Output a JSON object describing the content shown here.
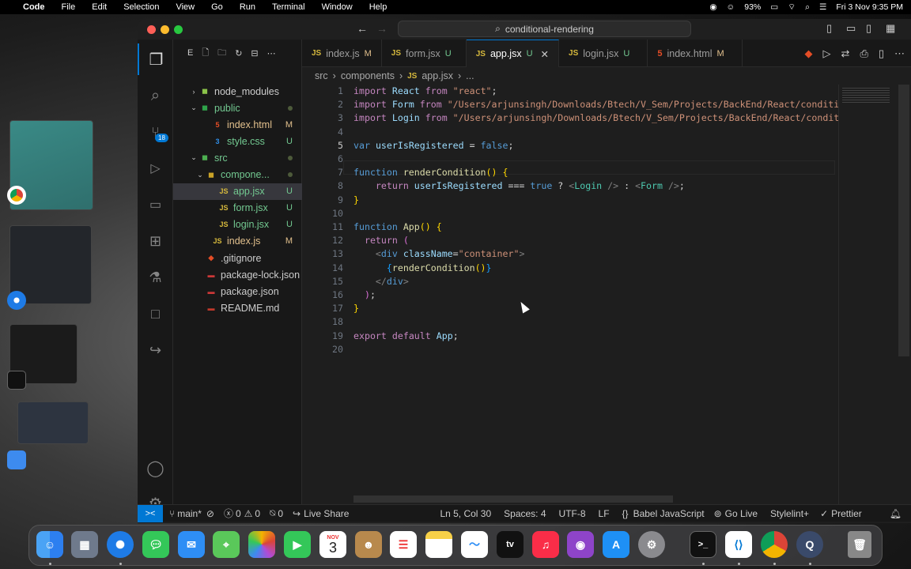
{
  "menubar": {
    "app": "Code",
    "items": [
      "File",
      "Edit",
      "Selection",
      "View",
      "Go",
      "Run",
      "Terminal",
      "Window",
      "Help"
    ],
    "battery": "93%",
    "clock": "Fri 3 Nov  9:35 PM"
  },
  "window": {
    "command_center": "conditional-rendering"
  },
  "activity": {
    "scm_badge": "18",
    "settings_badge": "1"
  },
  "sidebar": {
    "header": "E",
    "tree": [
      {
        "label": "node_modules",
        "icon": "folder-node-icon",
        "status": "",
        "kind": "folder"
      },
      {
        "label": "public",
        "icon": "folder-public-icon",
        "status": "dot",
        "kind": "folder"
      },
      {
        "label": "index.html",
        "icon": "html-icon",
        "status": "M",
        "kind": "file"
      },
      {
        "label": "style.css",
        "icon": "css-icon",
        "status": "U",
        "kind": "file"
      },
      {
        "label": "src",
        "icon": "folder-src-icon",
        "status": "dot",
        "kind": "folder"
      },
      {
        "label": "compone...",
        "icon": "folder-components-icon",
        "status": "dot",
        "kind": "folder"
      },
      {
        "label": "app.jsx",
        "icon": "js-icon",
        "status": "U",
        "kind": "file"
      },
      {
        "label": "form.jsx",
        "icon": "js-icon",
        "status": "U",
        "kind": "file"
      },
      {
        "label": "login.jsx",
        "icon": "js-icon",
        "status": "U",
        "kind": "file"
      },
      {
        "label": "index.js",
        "icon": "js-icon",
        "status": "M",
        "kind": "file"
      },
      {
        "label": ".gitignore",
        "icon": "git-icon",
        "status": "",
        "kind": "file"
      },
      {
        "label": "package-lock.json",
        "icon": "npm-icon",
        "status": "",
        "kind": "file"
      },
      {
        "label": "package.json",
        "icon": "npm-icon",
        "status": "",
        "kind": "file"
      },
      {
        "label": "README.md",
        "icon": "readme-icon",
        "status": "",
        "kind": "file"
      }
    ]
  },
  "tabs": [
    {
      "label": "index.js",
      "status": "M",
      "icon": "JS"
    },
    {
      "label": "form.jsx",
      "status": "U",
      "icon": "JS"
    },
    {
      "label": "app.jsx",
      "status": "U",
      "icon": "JS",
      "active": true
    },
    {
      "label": "login.jsx",
      "status": "U",
      "icon": "JS"
    },
    {
      "label": "index.html",
      "status": "M",
      "icon": "5"
    }
  ],
  "breadcrumb": [
    "src",
    "components",
    "app.jsx",
    "..."
  ],
  "code": {
    "line_numbers": [
      "1",
      "2",
      "3",
      "4",
      "5",
      "6",
      "7",
      "8",
      "9",
      "10",
      "11",
      "12",
      "13",
      "14",
      "15",
      "16",
      "17",
      "18",
      "19",
      "20"
    ],
    "import_path_form": "\"/Users/arjunsingh/Downloads/Btech/V_Sem/Projects/BackEnd/React/conditi",
    "import_path_login": "\"/Users/arjunsingh/Downloads/Btech/V_Sem/Projects/BackEnd/React/condit"
  },
  "statusbar": {
    "remote": "><",
    "branch": "main*",
    "errors": "0",
    "warnings": "0",
    "ports": "0",
    "live_share": "Live Share",
    "position": "Ln 5, Col 30",
    "spaces": "Spaces: 4",
    "encoding": "UTF-8",
    "eol": "LF",
    "language": "Babel JavaScript",
    "go_live": "Go Live",
    "stylelint": "Stylelint+",
    "prettier": "Prettier"
  },
  "dock": {
    "calendar_month": "NOV",
    "calendar_day": "3",
    "tv_label": "tv"
  },
  "colors": {
    "accent": "#0078d4",
    "untracked": "#73c991",
    "modified": "#e2c08d"
  }
}
